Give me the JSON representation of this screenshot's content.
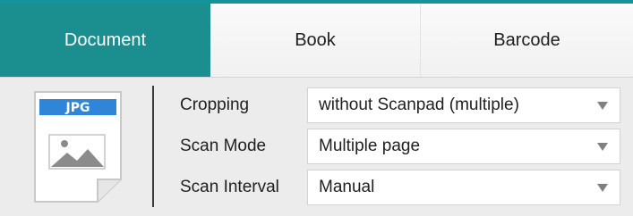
{
  "tabs": {
    "document": "Document",
    "book": "Book",
    "barcode": "Barcode"
  },
  "file_icon": {
    "type_label": "JPG",
    "icon": "image-file-icon",
    "badge_color": "#2f86d8"
  },
  "accent_color": "#1b8f90",
  "settings": {
    "cropping": {
      "label": "Cropping",
      "value": "without Scanpad (multiple)"
    },
    "scan_mode": {
      "label": "Scan Mode",
      "value": "Multiple page"
    },
    "scan_interval": {
      "label": "Scan Interval",
      "value": "Manual"
    }
  }
}
